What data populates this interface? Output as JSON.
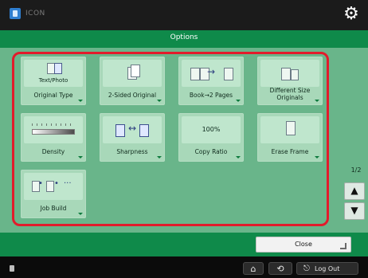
{
  "topbar": {
    "app_title": "ICON",
    "settings_icon": "gear-icon"
  },
  "options_bar": {
    "title": "Options"
  },
  "tiles": {
    "text_photo_value": "Text/Photo",
    "original_type": "Original Type",
    "two_sided_original": "2-Sided Original",
    "book_2_pages": "Book→2 Pages",
    "different_size_originals": "Different Size\nOriginals",
    "density": "Density",
    "sharpness": "Sharpness",
    "copy_ratio_value": "100%",
    "copy_ratio": "Copy Ratio",
    "erase_frame": "Erase Frame",
    "job_build": "Job Build"
  },
  "pagination": {
    "page_indicator": "1/2",
    "up_icon": "chevron-up-icon",
    "down_icon": "chevron-down-icon"
  },
  "footer": {
    "close_label": "Close"
  },
  "status": {
    "logout_label": "Log Out"
  },
  "colors": {
    "header_green": "#0f8a4a",
    "panel_green": "#69b58a",
    "tile_green": "#a8d8b9",
    "highlight_red": "#e21b2b"
  }
}
